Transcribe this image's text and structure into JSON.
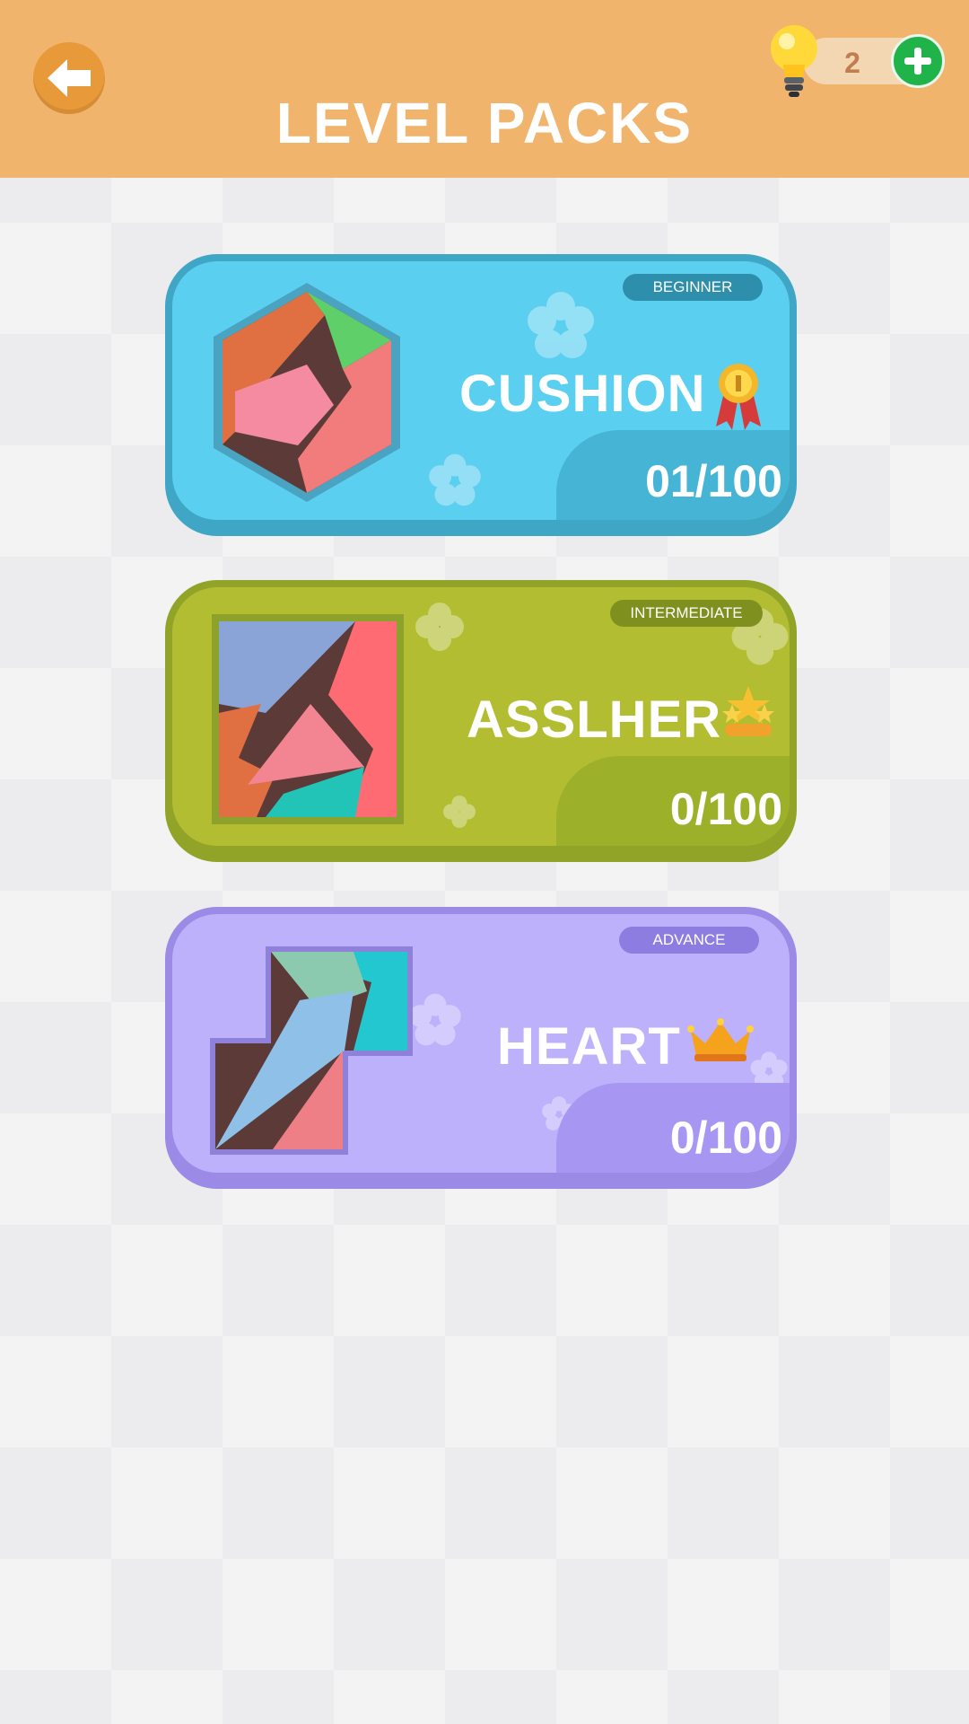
{
  "header": {
    "title": "LEVEL PACKS",
    "back_icon": "back-arrow-icon",
    "hint_icon": "lightbulb-icon",
    "hint_count": "2",
    "add_icon": "plus-icon",
    "bg_color": "#f1b46d"
  },
  "packs": [
    {
      "level": "BEGINNER",
      "name": "CUSHION",
      "progress": "01/100",
      "award_icon": "medal-icon",
      "thumbnail": "hexagon-puzzle-thumbnail",
      "color": "#5bcff0"
    },
    {
      "level": "INTERMEDIATE",
      "name": "ASSLHER",
      "progress": "0/100",
      "award_icon": "stars-trophy-icon",
      "thumbnail": "square-puzzle-thumbnail",
      "color": "#b3bd31"
    },
    {
      "level": "ADVANCE",
      "name": "HEART",
      "progress": "0/100",
      "award_icon": "crown-icon",
      "thumbnail": "zigzag-puzzle-thumbnail",
      "color": "#bdb1fc"
    }
  ]
}
